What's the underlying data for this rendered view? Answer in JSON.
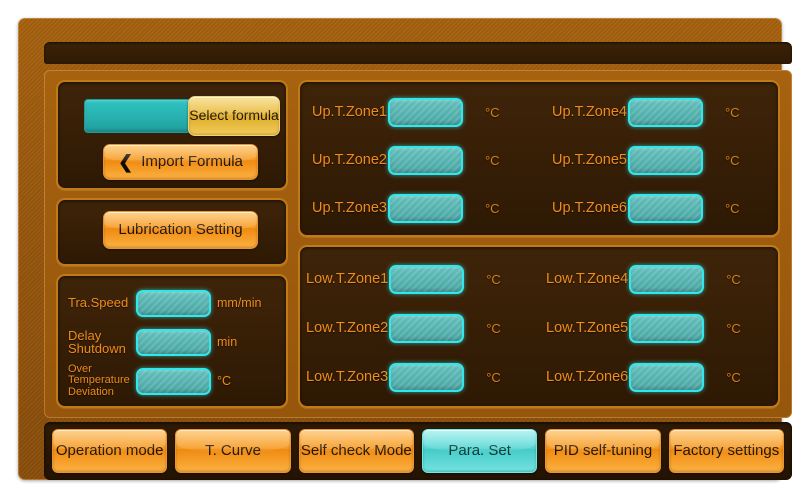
{
  "screen": {
    "title": "Para. Set",
    "colors": {
      "bezel": "#9a580d",
      "panel_bg": "#361e06",
      "panel_border": "#c07a18",
      "label_orange": "#f08c1a",
      "field_cyan": "#2fe8ec",
      "button_orange": "#f79a23",
      "active_tab_cyan": "#54d6d3"
    }
  },
  "formula_panel": {
    "display_value": "",
    "select_formula_label": "Select formula",
    "import_formula_label": "Import Formula",
    "import_icon": "chevron-left-icon"
  },
  "lubrication_panel": {
    "label": "Lubrication Setting"
  },
  "machine_params": {
    "rows": [
      {
        "label": "Tra.Speed",
        "value": "",
        "unit": "mm/min"
      },
      {
        "label": "Delay Shutdown",
        "value": "",
        "unit": "min"
      },
      {
        "label": "Over Temperature Deviation",
        "value": "",
        "unit": "°C"
      }
    ]
  },
  "upper_temperature": {
    "zones": [
      {
        "label": "Up.T.Zone1",
        "value": "",
        "unit": "°C"
      },
      {
        "label": "Up.T.Zone2",
        "value": "",
        "unit": "°C"
      },
      {
        "label": "Up.T.Zone3",
        "value": "",
        "unit": "°C"
      },
      {
        "label": "Up.T.Zone4",
        "value": "",
        "unit": "°C"
      },
      {
        "label": "Up.T.Zone5",
        "value": "",
        "unit": "°C"
      },
      {
        "label": "Up.T.Zone6",
        "value": "",
        "unit": "°C"
      }
    ]
  },
  "lower_temperature": {
    "zones": [
      {
        "label": "Low.T.Zone1",
        "value": "",
        "unit": "°C"
      },
      {
        "label": "Low.T.Zone2",
        "value": "",
        "unit": "°C"
      },
      {
        "label": "Low.T.Zone3",
        "value": "",
        "unit": "°C"
      },
      {
        "label": "Low.T.Zone4",
        "value": "",
        "unit": "°C"
      },
      {
        "label": "Low.T.Zone5",
        "value": "",
        "unit": "°C"
      },
      {
        "label": "Low.T.Zone6",
        "value": "",
        "unit": "°C"
      }
    ]
  },
  "navbar": {
    "tabs": [
      {
        "label": "Operation mode",
        "active": false
      },
      {
        "label": "T. Curve",
        "active": false
      },
      {
        "label": "Self check Mode",
        "active": false
      },
      {
        "label": "Para. Set",
        "active": true
      },
      {
        "label": "PID self-tuning",
        "active": false
      },
      {
        "label": "Factory settings",
        "active": false
      }
    ]
  }
}
